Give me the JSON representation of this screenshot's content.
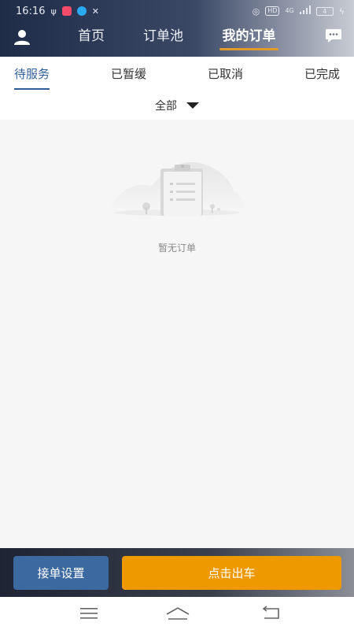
{
  "status_bar": {
    "time": "16:16",
    "network": "4G",
    "hd_label": "HD",
    "battery": "4"
  },
  "header": {
    "tabs": [
      {
        "label": "首页"
      },
      {
        "label": "订单池"
      },
      {
        "label": "我的订单"
      }
    ],
    "active_tab": 2,
    "accent": "#e39a2b"
  },
  "order_tabs": [
    {
      "label": "待服务"
    },
    {
      "label": "已暂缓"
    },
    {
      "label": "已取消"
    },
    {
      "label": "已完成"
    }
  ],
  "filter": {
    "selected": "全部"
  },
  "empty_state": {
    "message": "暂无订单"
  },
  "actions": {
    "settings_label": "接单设置",
    "depart_label": "点击出车"
  },
  "colors": {
    "primary_blue": "#3c6aa0",
    "action_orange": "#ef9900",
    "active_tab_blue": "#2f5f96"
  }
}
